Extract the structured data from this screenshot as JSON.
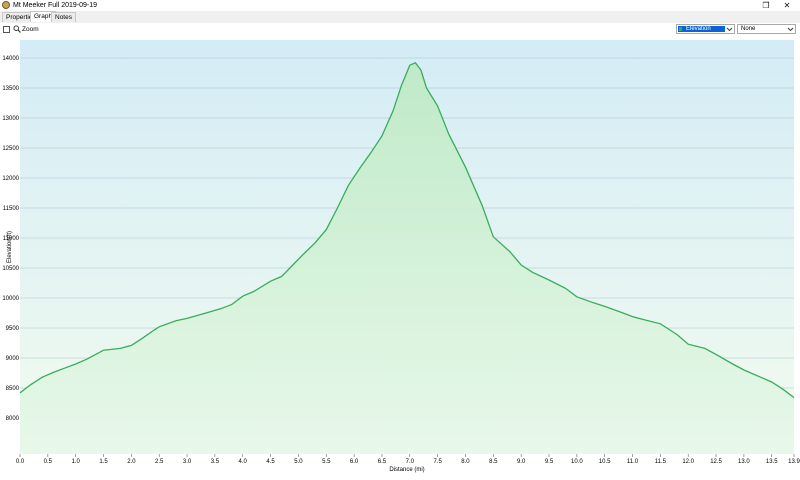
{
  "window": {
    "title": "Mt Meeker Full 2019-09-19",
    "restore_glyph": "❐",
    "close_glyph": "✕"
  },
  "tabs": [
    {
      "label": "Properties"
    },
    {
      "label": "Graph"
    },
    {
      "label": "Notes"
    }
  ],
  "active_tab": "Graph",
  "toolbar": {
    "zoom_label": "Zoom",
    "zoom_checked": false,
    "primary_select": "Elevation",
    "secondary_select": "None",
    "chevron_glyph": "⌵"
  },
  "colors": {
    "line": "#3aab5c",
    "fill_top": "#bfeac8",
    "fill_bottom": "#e8f8ea",
    "bg_top": "#d4ecf6",
    "bg_bottom": "#f2fbef",
    "grid": "#a9c3cf"
  },
  "chart_data": {
    "type": "area",
    "title": "",
    "xlabel": "Distance (mi)",
    "ylabel": "Elevation(ft)",
    "xlim": [
      0,
      13.9
    ],
    "ylim": [
      7400,
      14300
    ],
    "x_ticks": [
      "0.0",
      "0.5",
      "1.0",
      "1.5",
      "2.0",
      "2.5",
      "3.0",
      "3.5",
      "4.0",
      "4.5",
      "5.0",
      "5.5",
      "6.0",
      "6.5",
      "7.0",
      "7.5",
      "8.0",
      "8.5",
      "9.0",
      "9.5",
      "10.0",
      "10.5",
      "11.0",
      "11.5",
      "12.0",
      "12.5",
      "13.0",
      "13.5",
      "13.9"
    ],
    "y_ticks": [
      "8000",
      "8500",
      "9000",
      "9500",
      "10000",
      "10500",
      "11000",
      "11500",
      "12000",
      "12500",
      "13000",
      "13500",
      "14000"
    ],
    "grid": true,
    "series": [
      {
        "x": [
          0.0,
          0.2,
          0.4,
          0.6,
          0.8,
          1.0,
          1.2,
          1.4,
          1.5,
          1.8,
          2.0,
          2.2,
          2.4,
          2.5,
          2.8,
          3.0,
          3.3,
          3.6,
          3.8,
          4.0,
          4.2,
          4.5,
          4.7,
          4.9,
          5.1,
          5.3,
          5.5,
          5.7,
          5.9,
          6.1,
          6.3,
          6.5,
          6.7,
          6.85,
          7.0,
          7.1,
          7.2,
          7.3,
          7.5,
          7.7,
          8.0,
          8.3,
          8.5,
          8.8,
          9.0,
          9.2,
          9.5,
          9.8,
          10.0,
          10.3,
          10.5,
          10.8,
          11.0,
          11.2,
          11.5,
          11.8,
          12.0,
          12.3,
          12.5,
          12.8,
          13.0,
          13.3,
          13.5,
          13.7,
          13.9
        ],
        "y": [
          8420,
          8560,
          8680,
          8760,
          8830,
          8900,
          8980,
          9080,
          9130,
          9160,
          9210,
          9330,
          9460,
          9520,
          9620,
          9660,
          9740,
          9820,
          9890,
          10030,
          10110,
          10280,
          10360,
          10550,
          10740,
          10920,
          11140,
          11500,
          11880,
          12160,
          12420,
          12700,
          13120,
          13540,
          13880,
          13920,
          13800,
          13500,
          13200,
          12730,
          12180,
          11540,
          11020,
          10770,
          10550,
          10430,
          10300,
          10160,
          10020,
          9920,
          9860,
          9760,
          9690,
          9640,
          9570,
          9390,
          9230,
          9160,
          9060,
          8900,
          8800,
          8680,
          8600,
          8480,
          8340
        ]
      }
    ]
  }
}
